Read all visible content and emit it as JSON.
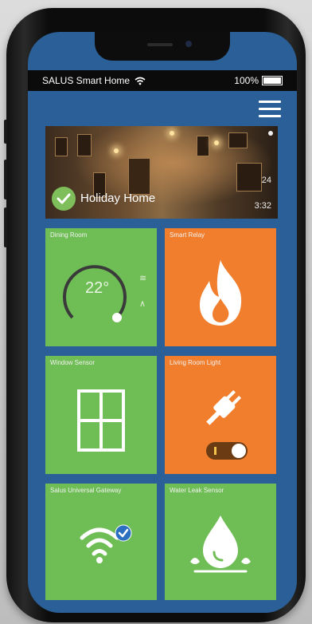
{
  "status_bar": {
    "carrier": "SALUS Smart Home",
    "battery": "100%"
  },
  "menu": {
    "icon": "hamburger-menu-icon"
  },
  "banner": {
    "title": "Holiday Home",
    "value_top": "24",
    "value_bottom": "3:32"
  },
  "tiles": [
    {
      "label": "Dining Room",
      "color": "#6fbd55",
      "setpoint": "22°",
      "up_icon": "plus-icon",
      "down_icon": "minus-icon"
    },
    {
      "label": "Smart Relay",
      "color": "#f07e2d",
      "icon": "flame-icon"
    },
    {
      "label": "Window Sensor",
      "color": "#6fbd55",
      "icon": "window-icon"
    },
    {
      "label": "Living Room Light",
      "color": "#f07e2d",
      "icon": "plug-icon",
      "toggle_state": "on"
    },
    {
      "label": "Salus Universal Gateway",
      "color": "#6fbd55",
      "icon": "wifi-check-icon"
    },
    {
      "label": "Water Leak Sensor",
      "color": "#6fbd55",
      "icon": "water-drop-icon"
    }
  ],
  "colors": {
    "screen_bg": "#2a5f97",
    "tile_green": "#6fbd55",
    "tile_orange": "#f07e2d"
  }
}
